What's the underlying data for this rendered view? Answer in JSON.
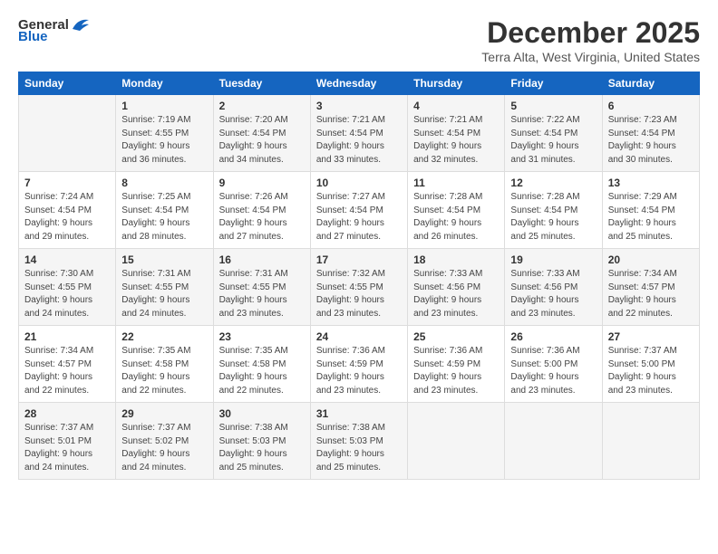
{
  "logo": {
    "general": "General",
    "blue": "Blue"
  },
  "title": "December 2025",
  "location": "Terra Alta, West Virginia, United States",
  "days_header": [
    "Sunday",
    "Monday",
    "Tuesday",
    "Wednesday",
    "Thursday",
    "Friday",
    "Saturday"
  ],
  "weeks": [
    [
      {
        "num": "",
        "info": ""
      },
      {
        "num": "1",
        "info": "Sunrise: 7:19 AM\nSunset: 4:55 PM\nDaylight: 9 hours\nand 36 minutes."
      },
      {
        "num": "2",
        "info": "Sunrise: 7:20 AM\nSunset: 4:54 PM\nDaylight: 9 hours\nand 34 minutes."
      },
      {
        "num": "3",
        "info": "Sunrise: 7:21 AM\nSunset: 4:54 PM\nDaylight: 9 hours\nand 33 minutes."
      },
      {
        "num": "4",
        "info": "Sunrise: 7:21 AM\nSunset: 4:54 PM\nDaylight: 9 hours\nand 32 minutes."
      },
      {
        "num": "5",
        "info": "Sunrise: 7:22 AM\nSunset: 4:54 PM\nDaylight: 9 hours\nand 31 minutes."
      },
      {
        "num": "6",
        "info": "Sunrise: 7:23 AM\nSunset: 4:54 PM\nDaylight: 9 hours\nand 30 minutes."
      }
    ],
    [
      {
        "num": "7",
        "info": "Sunrise: 7:24 AM\nSunset: 4:54 PM\nDaylight: 9 hours\nand 29 minutes."
      },
      {
        "num": "8",
        "info": "Sunrise: 7:25 AM\nSunset: 4:54 PM\nDaylight: 9 hours\nand 28 minutes."
      },
      {
        "num": "9",
        "info": "Sunrise: 7:26 AM\nSunset: 4:54 PM\nDaylight: 9 hours\nand 27 minutes."
      },
      {
        "num": "10",
        "info": "Sunrise: 7:27 AM\nSunset: 4:54 PM\nDaylight: 9 hours\nand 27 minutes."
      },
      {
        "num": "11",
        "info": "Sunrise: 7:28 AM\nSunset: 4:54 PM\nDaylight: 9 hours\nand 26 minutes."
      },
      {
        "num": "12",
        "info": "Sunrise: 7:28 AM\nSunset: 4:54 PM\nDaylight: 9 hours\nand 25 minutes."
      },
      {
        "num": "13",
        "info": "Sunrise: 7:29 AM\nSunset: 4:54 PM\nDaylight: 9 hours\nand 25 minutes."
      }
    ],
    [
      {
        "num": "14",
        "info": "Sunrise: 7:30 AM\nSunset: 4:55 PM\nDaylight: 9 hours\nand 24 minutes."
      },
      {
        "num": "15",
        "info": "Sunrise: 7:31 AM\nSunset: 4:55 PM\nDaylight: 9 hours\nand 24 minutes."
      },
      {
        "num": "16",
        "info": "Sunrise: 7:31 AM\nSunset: 4:55 PM\nDaylight: 9 hours\nand 23 minutes."
      },
      {
        "num": "17",
        "info": "Sunrise: 7:32 AM\nSunset: 4:55 PM\nDaylight: 9 hours\nand 23 minutes."
      },
      {
        "num": "18",
        "info": "Sunrise: 7:33 AM\nSunset: 4:56 PM\nDaylight: 9 hours\nand 23 minutes."
      },
      {
        "num": "19",
        "info": "Sunrise: 7:33 AM\nSunset: 4:56 PM\nDaylight: 9 hours\nand 23 minutes."
      },
      {
        "num": "20",
        "info": "Sunrise: 7:34 AM\nSunset: 4:57 PM\nDaylight: 9 hours\nand 22 minutes."
      }
    ],
    [
      {
        "num": "21",
        "info": "Sunrise: 7:34 AM\nSunset: 4:57 PM\nDaylight: 9 hours\nand 22 minutes."
      },
      {
        "num": "22",
        "info": "Sunrise: 7:35 AM\nSunset: 4:58 PM\nDaylight: 9 hours\nand 22 minutes."
      },
      {
        "num": "23",
        "info": "Sunrise: 7:35 AM\nSunset: 4:58 PM\nDaylight: 9 hours\nand 22 minutes."
      },
      {
        "num": "24",
        "info": "Sunrise: 7:36 AM\nSunset: 4:59 PM\nDaylight: 9 hours\nand 23 minutes."
      },
      {
        "num": "25",
        "info": "Sunrise: 7:36 AM\nSunset: 4:59 PM\nDaylight: 9 hours\nand 23 minutes."
      },
      {
        "num": "26",
        "info": "Sunrise: 7:36 AM\nSunset: 5:00 PM\nDaylight: 9 hours\nand 23 minutes."
      },
      {
        "num": "27",
        "info": "Sunrise: 7:37 AM\nSunset: 5:00 PM\nDaylight: 9 hours\nand 23 minutes."
      }
    ],
    [
      {
        "num": "28",
        "info": "Sunrise: 7:37 AM\nSunset: 5:01 PM\nDaylight: 9 hours\nand 24 minutes."
      },
      {
        "num": "29",
        "info": "Sunrise: 7:37 AM\nSunset: 5:02 PM\nDaylight: 9 hours\nand 24 minutes."
      },
      {
        "num": "30",
        "info": "Sunrise: 7:38 AM\nSunset: 5:03 PM\nDaylight: 9 hours\nand 25 minutes."
      },
      {
        "num": "31",
        "info": "Sunrise: 7:38 AM\nSunset: 5:03 PM\nDaylight: 9 hours\nand 25 minutes."
      },
      {
        "num": "",
        "info": ""
      },
      {
        "num": "",
        "info": ""
      },
      {
        "num": "",
        "info": ""
      }
    ]
  ]
}
